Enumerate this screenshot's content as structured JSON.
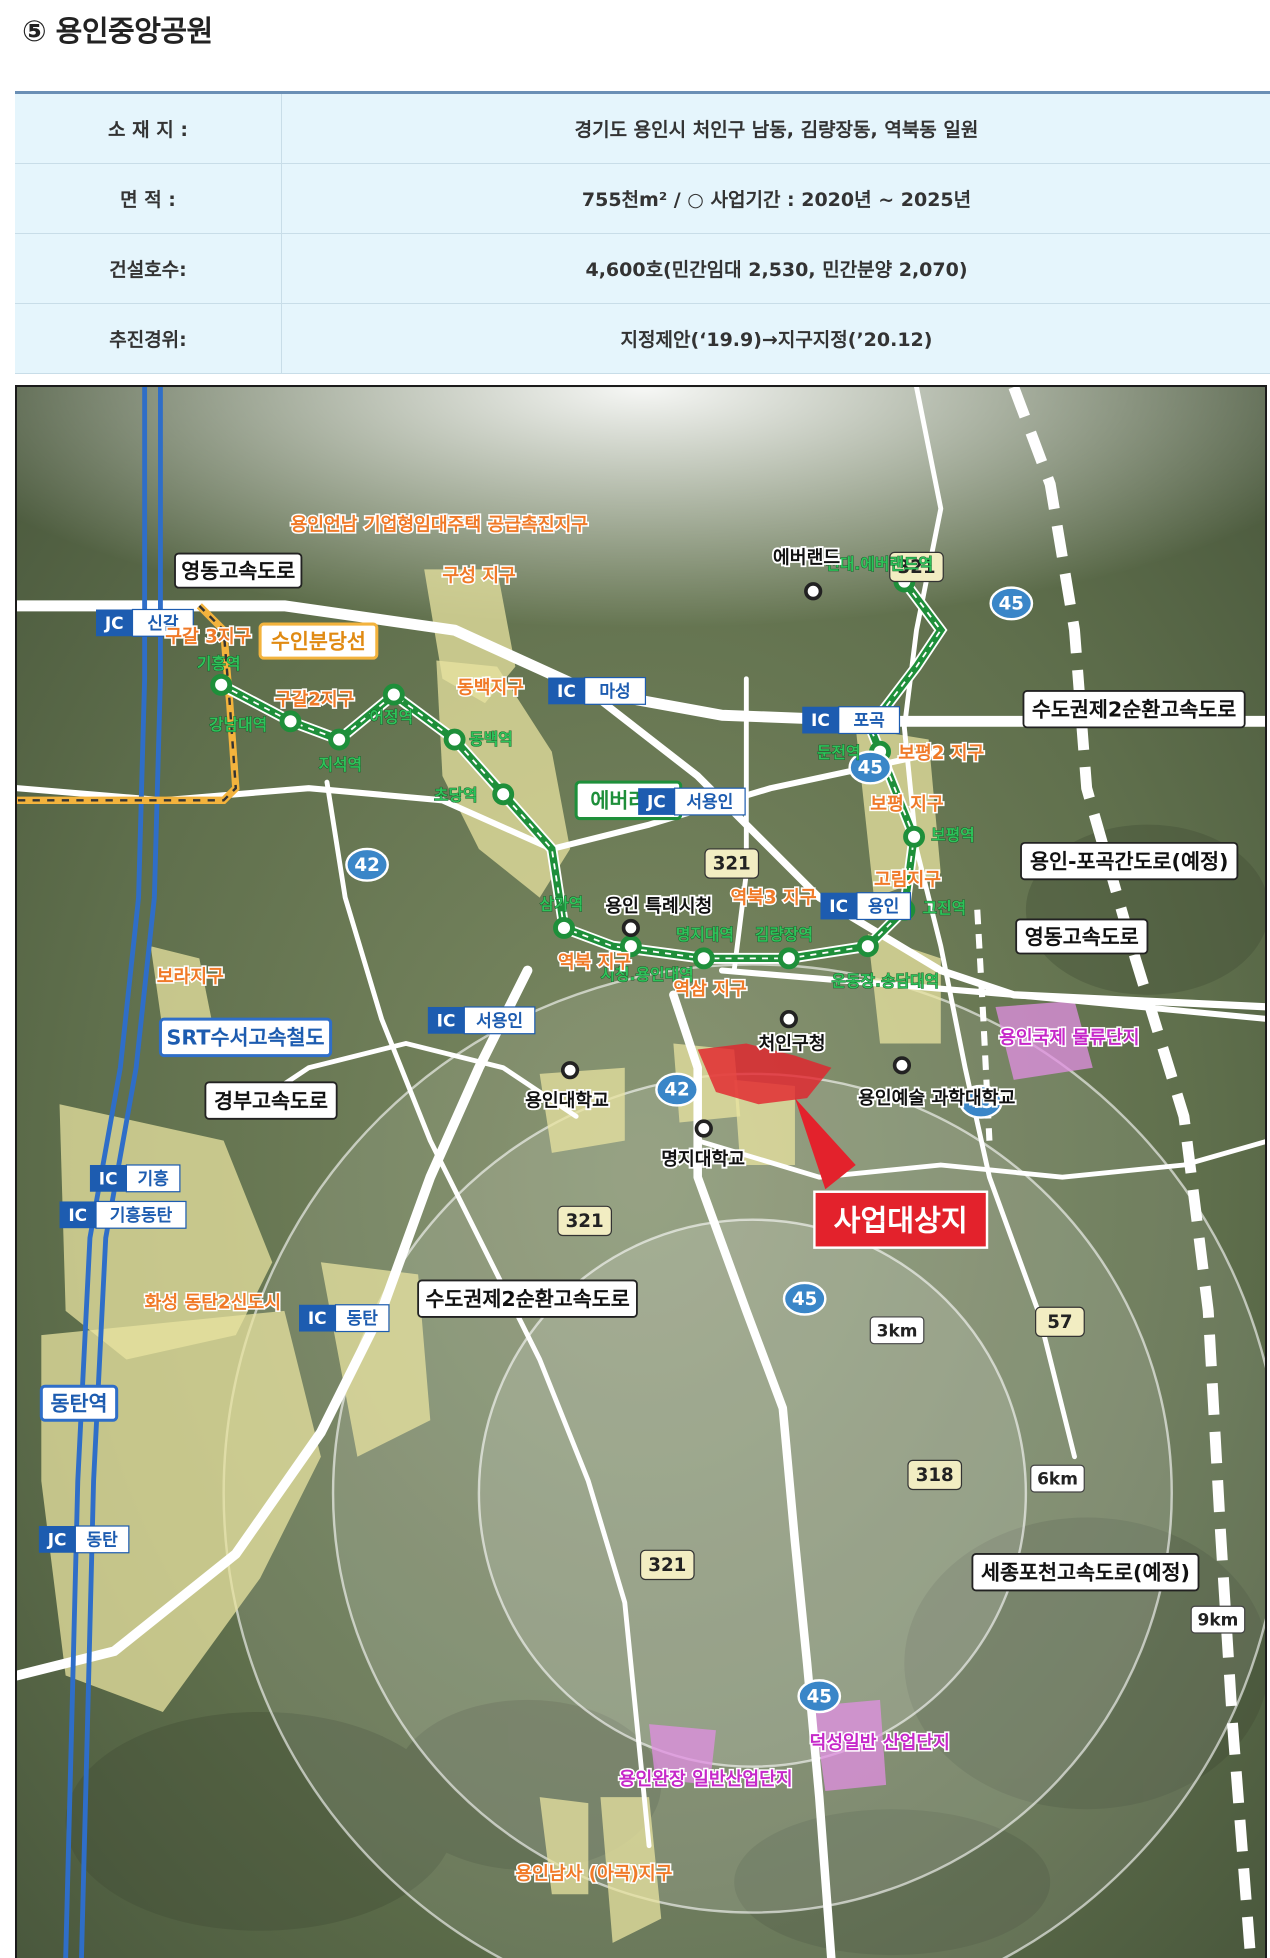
{
  "title": "⑤ 용인중앙공원",
  "info": [
    {
      "key": "소 재 지 :",
      "value": "경기도 용인시 처인구 남동, 김량장동, 역북동 일원"
    },
    {
      "key": "면 적 :",
      "value": "755천m² / ○ 사업기간 : 2020년 ~ 2025년"
    },
    {
      "key": "건설호수:",
      "value": "4,600호(민간임대 2,530, 민간분양 2,070)"
    },
    {
      "key": "추진경위:",
      "value": "지정제안(‘19.9)→지구지정(’20.12)"
    }
  ],
  "map": {
    "colors": {
      "terrain": "#5e6e4e",
      "district": "#e8e3a0",
      "road": "#ffffff",
      "rail": "#1e8f3a",
      "target": "#e3222c",
      "industrial": "#d46fd8",
      "label_orange": "#f07a28"
    },
    "road_labels": {
      "yeongdong_nw": "영동고속도로",
      "capital_ring_ne": "수도권제2순환고속도로",
      "yongin_pogok": "용인-포곡간도로(예정)",
      "yeongdong_e": "영동고속도로",
      "srt": "SRT수서고속철도",
      "gyeongbu": "경부고속도로",
      "capital_ring_s": "수도권제2순환고속도로",
      "sejong_pocheon": "세종포천고속도로(예정)",
      "suin_bundang": "수인분당선",
      "everline": "에버라인"
    },
    "interchanges": [
      {
        "type": "JC",
        "name": "신갈"
      },
      {
        "type": "IC",
        "name": "마성"
      },
      {
        "type": "IC",
        "name": "포곡"
      },
      {
        "type": "JC",
        "name": "서용인"
      },
      {
        "type": "IC",
        "name": "용인"
      },
      {
        "type": "IC",
        "name": "서용인"
      },
      {
        "type": "IC",
        "name": "기흥"
      },
      {
        "type": "IC",
        "name": "기흥동탄"
      },
      {
        "type": "IC",
        "name": "동탄"
      },
      {
        "type": "JC",
        "name": "동탄"
      }
    ],
    "route_numbers": {
      "r321_top": "321",
      "r45_top": "45",
      "r45_mid": "45",
      "r42_w": "42",
      "r321_mid": "321",
      "r42_c": "42",
      "r45_e": "45",
      "r321_low": "321",
      "r45_c": "45",
      "r57": "57",
      "r318": "318",
      "r321_bot": "321",
      "r45_bot": "45"
    },
    "distances": [
      "3km",
      "6km",
      "9km"
    ],
    "stations": {
      "giheung": "기흥역",
      "gangnam": "강남대역",
      "jiseok": "지석역",
      "eojeong": "어정역",
      "dongbaek": "동백역",
      "chodang": "초당역",
      "samga": "삼가역",
      "sicheong": "시청.용인대역",
      "myeongji": "명지대역",
      "gimnyangjang": "김량장역",
      "undong": "운동장.송담대역",
      "gojin": "고진역",
      "bopyeong": "보평역",
      "dunjeon": "둔전역",
      "everland": "전대.에버랜드역",
      "dongtan": "동탄역"
    },
    "districts": {
      "yongin_eonnam": "용인언남 기업형임대주택 공급촉진지구",
      "guseong": "구성 지구",
      "gugal3": "구갈 3지구",
      "gugal2": "구갈2지구",
      "dongbaek": "동백지구",
      "bora": "보라지구",
      "bopyeong2": "보평2 지구",
      "bopyeong": "보평 지구",
      "gorim": "고림지구",
      "yeokbuk3": "역북3 지구",
      "yeokbuk": "역북 지구",
      "yeoksam": "역삼 지구",
      "hwaseong": "화성 동탄2신도시",
      "namsa": "용인남사 (아곡)지구"
    },
    "industrial": {
      "logistics": "용인국제 물류단지",
      "deokseong": "덕성일반 산업단지",
      "wanjang": "용인완장 일반산업단지"
    },
    "landmarks": {
      "everland": "에버랜드",
      "city_hall": "용인 특례시청",
      "cheoin_office": "처인구청",
      "yongin_univ": "용인대학교",
      "myongji_univ": "명지대학교",
      "art_college": "용인예술 과학대학교"
    },
    "target": "사업대상지"
  }
}
